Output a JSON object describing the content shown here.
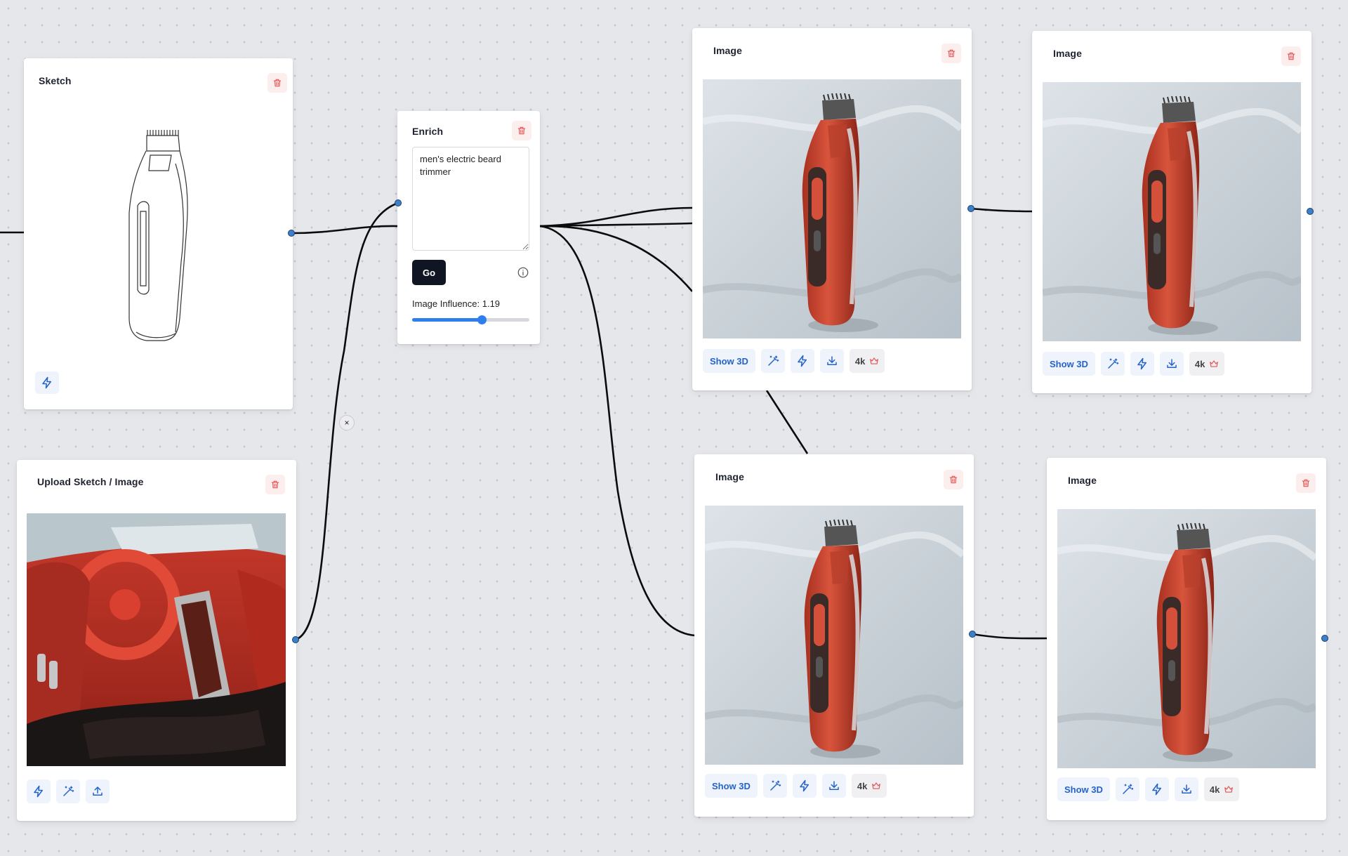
{
  "canvas": {
    "accent_color": "#2563c9",
    "danger_color": "#e25555",
    "port_color": "#3e7fcc",
    "disconnect_label": "×"
  },
  "nodes": {
    "sketch": {
      "title": "Sketch",
      "actions": [
        "lightning-icon"
      ]
    },
    "upload": {
      "title": "Upload Sketch / Image",
      "actions": [
        "lightning-icon",
        "magic-wand-icon",
        "upload-icon"
      ]
    },
    "enrich": {
      "title": "Enrich",
      "prompt_value": "men's electric beard trimmer",
      "go_label": "Go",
      "influence_label": "Image Influence: 1.19",
      "influence_fraction": 0.59
    },
    "image_nodes": [
      {
        "title": "Image"
      },
      {
        "title": "Image"
      },
      {
        "title": "Image"
      },
      {
        "title": "Image"
      }
    ],
    "image_toolbar": {
      "show3d_label": "Show 3D",
      "k4_label": "4k",
      "icons": [
        "magic-wand-icon",
        "lightning-icon",
        "download-icon",
        "crown-icon"
      ]
    }
  }
}
